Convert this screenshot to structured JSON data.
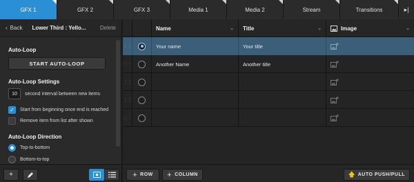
{
  "tabs": [
    {
      "label": "GFX 1",
      "active": true
    },
    {
      "label": "GFX 2",
      "active": false
    },
    {
      "label": "GFX 3",
      "active": false
    },
    {
      "label": "Media 1",
      "active": false
    },
    {
      "label": "Media 2",
      "active": false
    },
    {
      "label": "Stream",
      "active": false
    },
    {
      "label": "Transitions",
      "active": false
    }
  ],
  "tab_overflow_icon": "▸|",
  "panel": {
    "back_label": "Back",
    "title": "Lower Third : Yello...",
    "delete_label": "Delete",
    "autoloop_title": "Auto-Loop",
    "autoloop_button": "START AUTO-LOOP",
    "settings_title": "Auto-Loop Settings",
    "interval_value": "10",
    "interval_label": "second interval between new items",
    "check_restart": {
      "label": "Start from beginning once end is reached",
      "checked": true
    },
    "check_remove": {
      "label": "Remove item from list after shown",
      "checked": false
    },
    "direction_title": "Auto-Loop Direction",
    "direction_options": [
      {
        "label": "Top-to-bottom",
        "checked": true
      },
      {
        "label": "Bottom-to-top",
        "checked": false
      }
    ]
  },
  "table": {
    "columns": {
      "name": "Name",
      "title": "Title",
      "image": "Image"
    },
    "rows": [
      {
        "name": "Your name",
        "title": "Your title",
        "selected": true
      },
      {
        "name": "Another Name",
        "title": "Another title",
        "selected": false
      },
      {
        "name": "",
        "title": "",
        "selected": false
      },
      {
        "name": "",
        "title": "",
        "selected": false
      },
      {
        "name": "",
        "title": "",
        "selected": false
      }
    ]
  },
  "toolbar": {
    "add_row_label": "ROW",
    "add_column_label": "COLUMN",
    "auto_push_pull_label": "AUTO PUSH/PULL"
  },
  "colors": {
    "accent": "#2b8fd6",
    "selected_row": "#3b5e79",
    "arrow": "#f5c400"
  }
}
